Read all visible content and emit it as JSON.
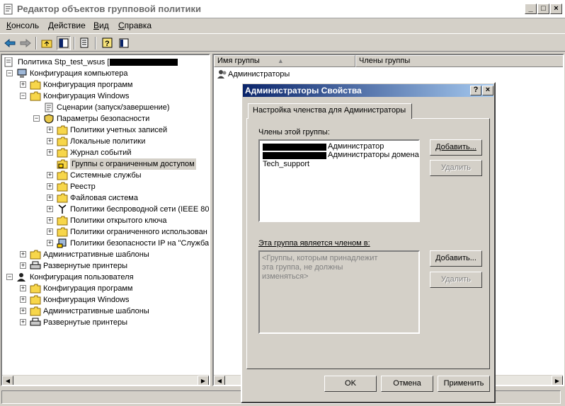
{
  "window": {
    "title": "Редактор объектов групповой политики",
    "controls": {
      "minimize": "_",
      "maximize": "□",
      "close": "×"
    }
  },
  "menu": [
    {
      "label": "Консоль",
      "ul": "К",
      "rest": "онсоль"
    },
    {
      "label": "Действие",
      "ul": "Д",
      "rest": "ействие"
    },
    {
      "label": "Вид",
      "ul": "В",
      "rest": "ид"
    },
    {
      "label": "Справка",
      "ul": "С",
      "rest": "правка"
    }
  ],
  "toolbar": {
    "icons": [
      "back-icon",
      "forward-icon",
      "up-folder-icon",
      "show-tree-icon",
      "export-list-icon",
      "help-icon",
      "console-icon"
    ]
  },
  "tree": {
    "root": "Политика Stp_test_wsus [",
    "items": [
      "Конфигурация компьютера",
      "Конфигурация программ",
      "Конфигурация Windows",
      "Сценарии (запуск/завершение)",
      "Параметры безопасности",
      "Политики учетных записей",
      "Локальные политики",
      "Журнал событий",
      "Группы с ограниченным доступом",
      "Системные службы",
      "Реестр",
      "Файловая система",
      "Политики беспроводной сети (IEEE 80",
      "Политики открытого ключа",
      "Политики ограниченного использован",
      "Политики безопасности IP на \"Служба",
      "Административные шаблоны",
      "Развернутые принтеры",
      "Конфигурация пользователя",
      "Конфигурация программ",
      "Конфигурация Windows",
      "Административные шаблоны",
      "Развернутые принтеры"
    ]
  },
  "list": {
    "columns": [
      "Имя группы",
      "Члены группы"
    ],
    "sort_indicator": "▲",
    "rows": [
      "Администраторы"
    ]
  },
  "dialog": {
    "title": "Администраторы Свойства",
    "help": "?",
    "close": "×",
    "tab": "Настройка членства для Администраторы",
    "members_label": "Члены этой группы:",
    "members": [
      "Администратор",
      "Администраторы домена",
      "Tech_support"
    ],
    "add_label_1": "Добавить...",
    "remove_label_1": "Удалить",
    "memberof_label": "Эта группа является членом в:",
    "memberof_placeholder": "<Группы, которым принадлежит эта группа, не должны изменяться>",
    "add_label_2": "Добавить...",
    "remove_label_2": "Удалить",
    "ok": "OK",
    "cancel": "Отмена",
    "apply": "Применить"
  }
}
